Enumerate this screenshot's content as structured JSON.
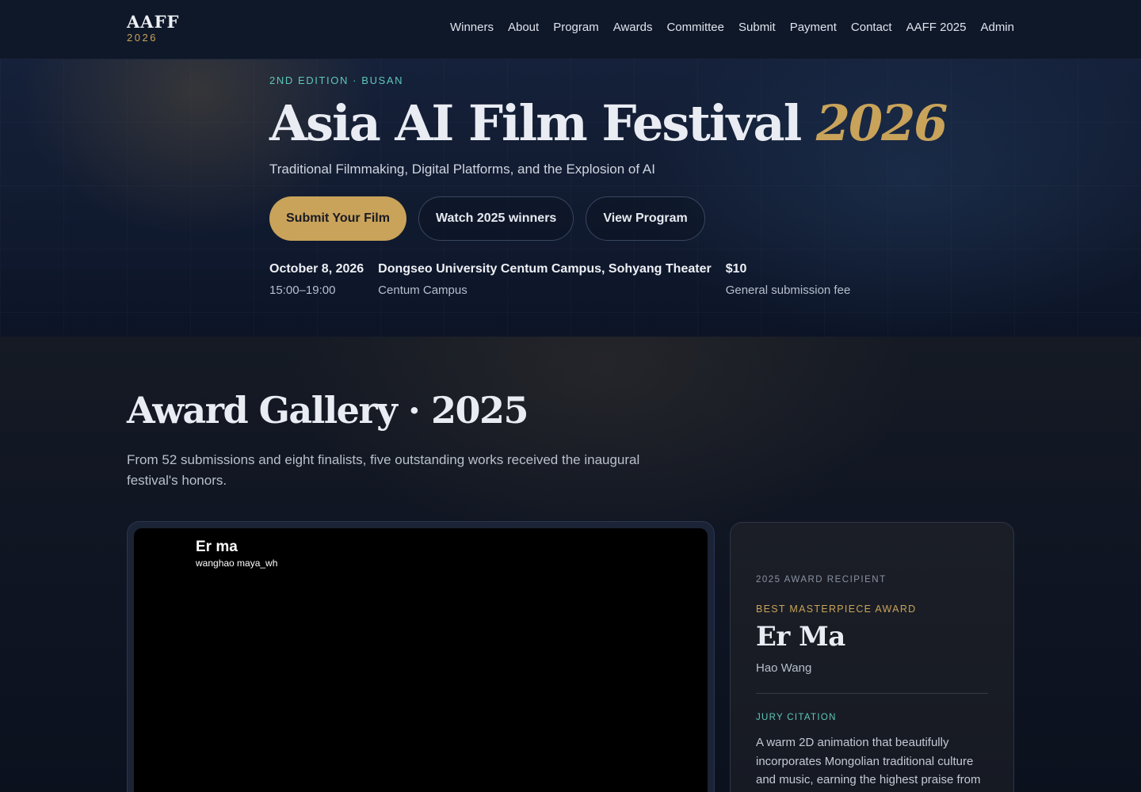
{
  "header": {
    "logo_main": "AAFF",
    "logo_sub": "2026",
    "nav": [
      "Winners",
      "About",
      "Program",
      "Awards",
      "Committee",
      "Submit",
      "Payment",
      "Contact",
      "AAFF 2025",
      "Admin"
    ]
  },
  "hero": {
    "eyebrow": "2ND EDITION · BUSAN",
    "title": "Asia AI Film Festival",
    "title_year": "2026",
    "tagline": "Traditional Filmmaking, Digital Platforms, and the Explosion of AI",
    "buttons": {
      "submit": "Submit Your Film",
      "watch": "Watch 2025 winners",
      "program": "View Program"
    },
    "meta": [
      {
        "main": "October 8, 2026",
        "sub": "15:00–19:00"
      },
      {
        "main": "Dongseo University Centum Campus, Sohyang Theater",
        "sub": "Centum Campus"
      },
      {
        "main": "$10",
        "sub": "General submission fee"
      }
    ]
  },
  "gallery": {
    "title": "Award Gallery · 2025",
    "description": "From 52 submissions and eight finalists, five outstanding works received the inaugural festival's honors.",
    "video": {
      "title": "Er ma",
      "channel": "wanghao maya_wh"
    },
    "recipient": {
      "label": "2025 AWARD RECIPIENT",
      "award": "BEST MASTERPIECE AWARD",
      "film": "Er Ma",
      "director": "Hao Wang",
      "citation_label": "JURY CITATION",
      "citation": "A warm 2D animation that beautifully incorporates Mongolian traditional culture and music, earning the highest praise from"
    }
  },
  "colors": {
    "accent_gold": "#c9a35a",
    "accent_teal": "#5fc7b8",
    "background": "#0b1220"
  }
}
